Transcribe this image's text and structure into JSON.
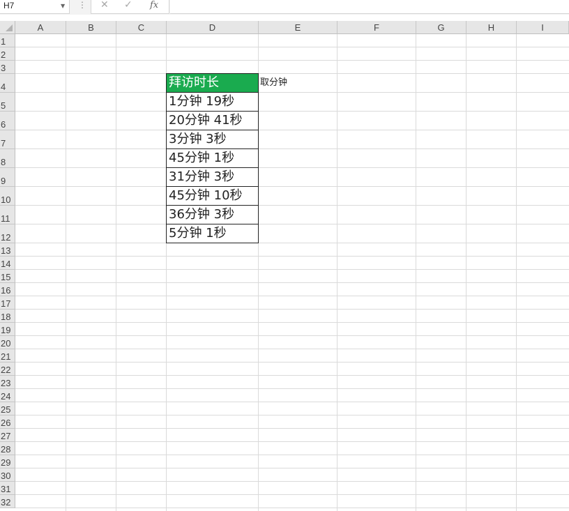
{
  "formula_bar": {
    "name_box": "H7",
    "cancel_icon": "cancel-icon",
    "enter_icon": "check-icon",
    "fx_label": "fx",
    "formula": ""
  },
  "columns": [
    "A",
    "B",
    "C",
    "D",
    "E",
    "F",
    "G",
    "H",
    "I"
  ],
  "rows": [
    "1",
    "2",
    "3",
    "4",
    "5",
    "6",
    "7",
    "8",
    "9",
    "10",
    "11",
    "12",
    "13",
    "14",
    "15",
    "16",
    "17",
    "18",
    "19",
    "20",
    "21",
    "22",
    "23",
    "24",
    "25",
    "26",
    "27",
    "28",
    "29",
    "30",
    "31",
    "32"
  ],
  "cells": {
    "D4": "拜访时长",
    "E4": "取分钟",
    "D5": "1分钟 19秒",
    "D6": "20分钟 41秒",
    "D7": "3分钟 3秒",
    "D8": "45分钟 1秒",
    "D9": "31分钟 3秒",
    "D10": "45分钟 10秒",
    "D11": "36分钟 3秒",
    "D12": "5分钟 1秒"
  },
  "colors": {
    "header_fill": "#1aab4f",
    "header_text": "#ffffff"
  }
}
